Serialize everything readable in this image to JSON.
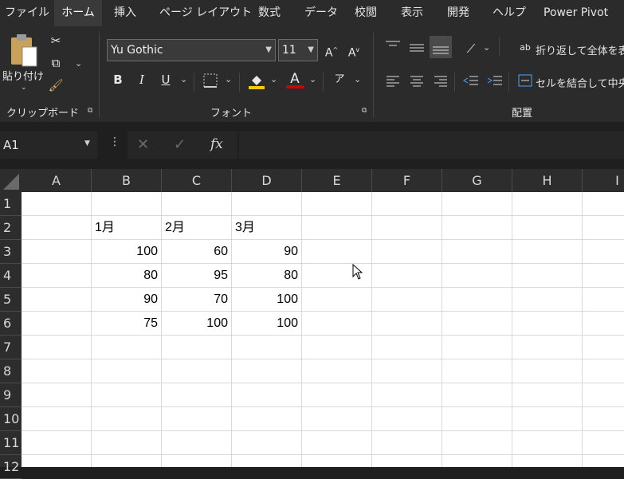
{
  "menu": {
    "tabs": [
      "ファイル",
      "ホーム",
      "挿入",
      "ページ レイアウト",
      "数式",
      "データ",
      "校閲",
      "表示",
      "開発",
      "ヘルプ",
      "Power Pivot"
    ],
    "active": "ホーム"
  },
  "ribbon": {
    "clipboard": {
      "paste_label": "貼り付け",
      "group_label": "クリップボード"
    },
    "font": {
      "font_name": "Yu Gothic",
      "font_size": "11",
      "group_label": "フォント",
      "bold": "B",
      "italic": "I",
      "underline": "U",
      "color_a": "A"
    },
    "alignment": {
      "wrap_text": "折り返して全体を表",
      "merge_center": "セルを結合して中央",
      "group_label": "配置"
    }
  },
  "formula_bar": {
    "name_box": "A1",
    "fx": "fx",
    "formula": ""
  },
  "sheet": {
    "columns": [
      "A",
      "B",
      "C",
      "D",
      "E",
      "F",
      "G",
      "H",
      "I"
    ],
    "rows": [
      "1",
      "2",
      "3",
      "4",
      "5",
      "6",
      "7",
      "8",
      "9",
      "10",
      "11",
      "12"
    ],
    "data": [
      [
        "",
        "",
        "",
        "",
        "",
        "",
        "",
        "",
        ""
      ],
      [
        "",
        "1月",
        "2月",
        "3月",
        "",
        "",
        "",
        "",
        ""
      ],
      [
        "",
        "100",
        "60",
        "90",
        "",
        "",
        "",
        "",
        ""
      ],
      [
        "",
        "80",
        "95",
        "80",
        "",
        "",
        "",
        "",
        ""
      ],
      [
        "",
        "90",
        "70",
        "100",
        "",
        "",
        "",
        "",
        ""
      ],
      [
        "",
        "75",
        "100",
        "100",
        "",
        "",
        "",
        "",
        ""
      ]
    ]
  },
  "colors": {
    "fill_accent": "#f2c811",
    "font_accent": "#d00000"
  }
}
